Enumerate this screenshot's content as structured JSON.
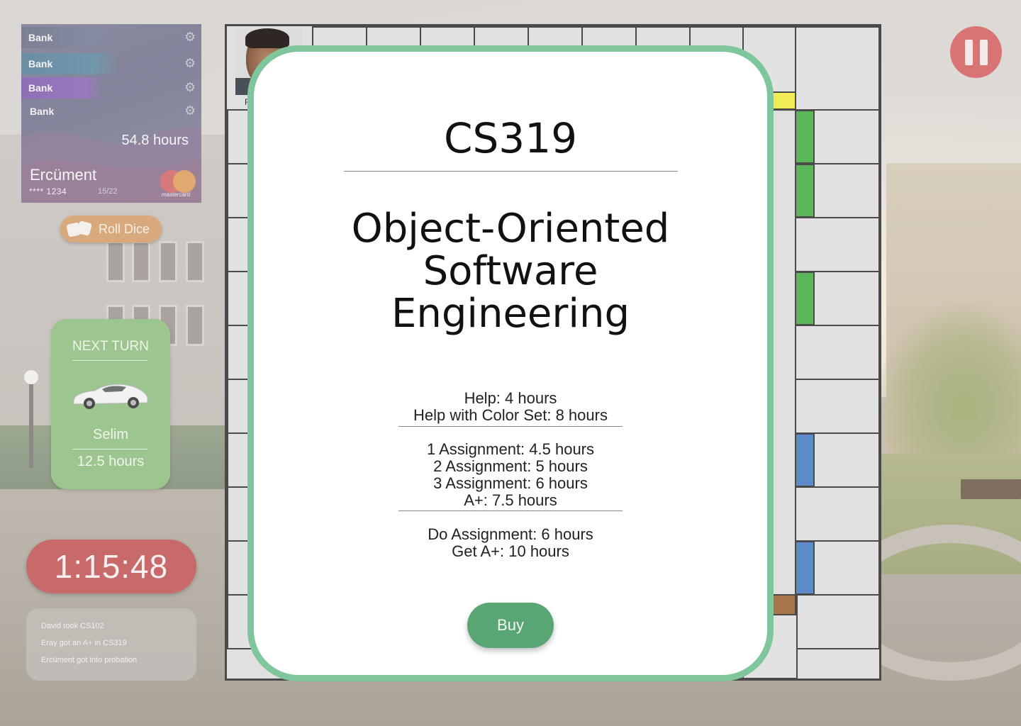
{
  "bank_card": {
    "rows": [
      {
        "label": "Bank",
        "icon": "gear-icon",
        "color": "#7a7e92"
      },
      {
        "label": "Bank",
        "icon": "gear-icon",
        "color": "#6a8aa0"
      },
      {
        "label": "Bank",
        "icon": "gear-icon",
        "color": "#8d6fb3"
      },
      {
        "label": "Bank",
        "icon": "gear-icon",
        "color": "#84849a"
      }
    ],
    "hours": "54.8 hours",
    "owner": "Ercüment",
    "card_number": "**** 1234",
    "expiry": "15/22",
    "brand": "mastercard"
  },
  "roll_dice": {
    "label": "Roll Dice",
    "icon": "dice-icon"
  },
  "next_turn": {
    "title": "NEXT TURN",
    "token_icon": "car-icon",
    "player": "Selim",
    "hours": "12.5 hours",
    "color": "#9dc58f"
  },
  "timer": {
    "value": "1:15:48",
    "color": "#c96a6a"
  },
  "log": {
    "entries": [
      "David took CS102",
      "Eray got an A+ in CS319",
      "Ercüment got into probation"
    ]
  },
  "pause": {
    "icon": "pause-icon",
    "color": "#d97474"
  },
  "board": {
    "corner_label": "F",
    "color_groups": [
      "#f1eb55",
      "#5cb65a",
      "#5b8cc8",
      "#a7754a"
    ]
  },
  "modal": {
    "code": "CS319",
    "title_lines": [
      "Object-Oriented",
      "Software",
      "Engineering"
    ],
    "help": [
      "Help: 4 hours",
      "Help with Color Set: 8 hours"
    ],
    "assignments": [
      "1 Assignment: 4.5 hours",
      "2 Assignment: 5 hours",
      "3 Assignment: 6 hours",
      "A+: 7.5 hours"
    ],
    "actions": [
      "Do Assignment: 6 hours",
      "Get A+: 10 hours"
    ],
    "buy_label": "Buy",
    "border_color": "#80c69c",
    "buy_color": "#5aa574"
  }
}
